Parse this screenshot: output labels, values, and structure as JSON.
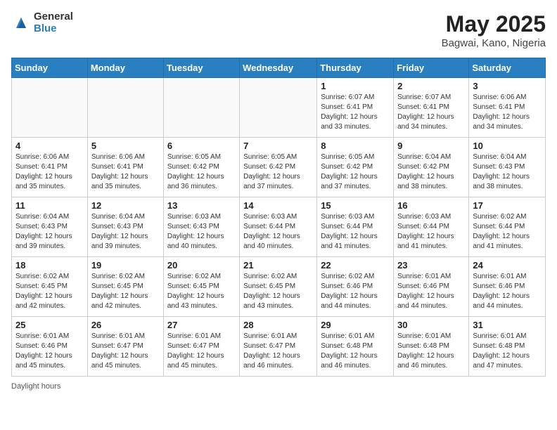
{
  "header": {
    "logo_line1": "General",
    "logo_line2": "Blue",
    "title": "May 2025",
    "subtitle": "Bagwai, Kano, Nigeria"
  },
  "days_of_week": [
    "Sunday",
    "Monday",
    "Tuesday",
    "Wednesday",
    "Thursday",
    "Friday",
    "Saturday"
  ],
  "weeks": [
    [
      {
        "day": "",
        "info": ""
      },
      {
        "day": "",
        "info": ""
      },
      {
        "day": "",
        "info": ""
      },
      {
        "day": "",
        "info": ""
      },
      {
        "day": "1",
        "info": "Sunrise: 6:07 AM\nSunset: 6:41 PM\nDaylight: 12 hours\nand 33 minutes."
      },
      {
        "day": "2",
        "info": "Sunrise: 6:07 AM\nSunset: 6:41 PM\nDaylight: 12 hours\nand 34 minutes."
      },
      {
        "day": "3",
        "info": "Sunrise: 6:06 AM\nSunset: 6:41 PM\nDaylight: 12 hours\nand 34 minutes."
      }
    ],
    [
      {
        "day": "4",
        "info": "Sunrise: 6:06 AM\nSunset: 6:41 PM\nDaylight: 12 hours\nand 35 minutes."
      },
      {
        "day": "5",
        "info": "Sunrise: 6:06 AM\nSunset: 6:41 PM\nDaylight: 12 hours\nand 35 minutes."
      },
      {
        "day": "6",
        "info": "Sunrise: 6:05 AM\nSunset: 6:42 PM\nDaylight: 12 hours\nand 36 minutes."
      },
      {
        "day": "7",
        "info": "Sunrise: 6:05 AM\nSunset: 6:42 PM\nDaylight: 12 hours\nand 37 minutes."
      },
      {
        "day": "8",
        "info": "Sunrise: 6:05 AM\nSunset: 6:42 PM\nDaylight: 12 hours\nand 37 minutes."
      },
      {
        "day": "9",
        "info": "Sunrise: 6:04 AM\nSunset: 6:42 PM\nDaylight: 12 hours\nand 38 minutes."
      },
      {
        "day": "10",
        "info": "Sunrise: 6:04 AM\nSunset: 6:43 PM\nDaylight: 12 hours\nand 38 minutes."
      }
    ],
    [
      {
        "day": "11",
        "info": "Sunrise: 6:04 AM\nSunset: 6:43 PM\nDaylight: 12 hours\nand 39 minutes."
      },
      {
        "day": "12",
        "info": "Sunrise: 6:04 AM\nSunset: 6:43 PM\nDaylight: 12 hours\nand 39 minutes."
      },
      {
        "day": "13",
        "info": "Sunrise: 6:03 AM\nSunset: 6:43 PM\nDaylight: 12 hours\nand 40 minutes."
      },
      {
        "day": "14",
        "info": "Sunrise: 6:03 AM\nSunset: 6:44 PM\nDaylight: 12 hours\nand 40 minutes."
      },
      {
        "day": "15",
        "info": "Sunrise: 6:03 AM\nSunset: 6:44 PM\nDaylight: 12 hours\nand 41 minutes."
      },
      {
        "day": "16",
        "info": "Sunrise: 6:03 AM\nSunset: 6:44 PM\nDaylight: 12 hours\nand 41 minutes."
      },
      {
        "day": "17",
        "info": "Sunrise: 6:02 AM\nSunset: 6:44 PM\nDaylight: 12 hours\nand 41 minutes."
      }
    ],
    [
      {
        "day": "18",
        "info": "Sunrise: 6:02 AM\nSunset: 6:45 PM\nDaylight: 12 hours\nand 42 minutes."
      },
      {
        "day": "19",
        "info": "Sunrise: 6:02 AM\nSunset: 6:45 PM\nDaylight: 12 hours\nand 42 minutes."
      },
      {
        "day": "20",
        "info": "Sunrise: 6:02 AM\nSunset: 6:45 PM\nDaylight: 12 hours\nand 43 minutes."
      },
      {
        "day": "21",
        "info": "Sunrise: 6:02 AM\nSunset: 6:45 PM\nDaylight: 12 hours\nand 43 minutes."
      },
      {
        "day": "22",
        "info": "Sunrise: 6:02 AM\nSunset: 6:46 PM\nDaylight: 12 hours\nand 44 minutes."
      },
      {
        "day": "23",
        "info": "Sunrise: 6:01 AM\nSunset: 6:46 PM\nDaylight: 12 hours\nand 44 minutes."
      },
      {
        "day": "24",
        "info": "Sunrise: 6:01 AM\nSunset: 6:46 PM\nDaylight: 12 hours\nand 44 minutes."
      }
    ],
    [
      {
        "day": "25",
        "info": "Sunrise: 6:01 AM\nSunset: 6:46 PM\nDaylight: 12 hours\nand 45 minutes."
      },
      {
        "day": "26",
        "info": "Sunrise: 6:01 AM\nSunset: 6:47 PM\nDaylight: 12 hours\nand 45 minutes."
      },
      {
        "day": "27",
        "info": "Sunrise: 6:01 AM\nSunset: 6:47 PM\nDaylight: 12 hours\nand 45 minutes."
      },
      {
        "day": "28",
        "info": "Sunrise: 6:01 AM\nSunset: 6:47 PM\nDaylight: 12 hours\nand 46 minutes."
      },
      {
        "day": "29",
        "info": "Sunrise: 6:01 AM\nSunset: 6:48 PM\nDaylight: 12 hours\nand 46 minutes."
      },
      {
        "day": "30",
        "info": "Sunrise: 6:01 AM\nSunset: 6:48 PM\nDaylight: 12 hours\nand 46 minutes."
      },
      {
        "day": "31",
        "info": "Sunrise: 6:01 AM\nSunset: 6:48 PM\nDaylight: 12 hours\nand 47 minutes."
      }
    ]
  ],
  "footer": {
    "note": "Daylight hours"
  }
}
